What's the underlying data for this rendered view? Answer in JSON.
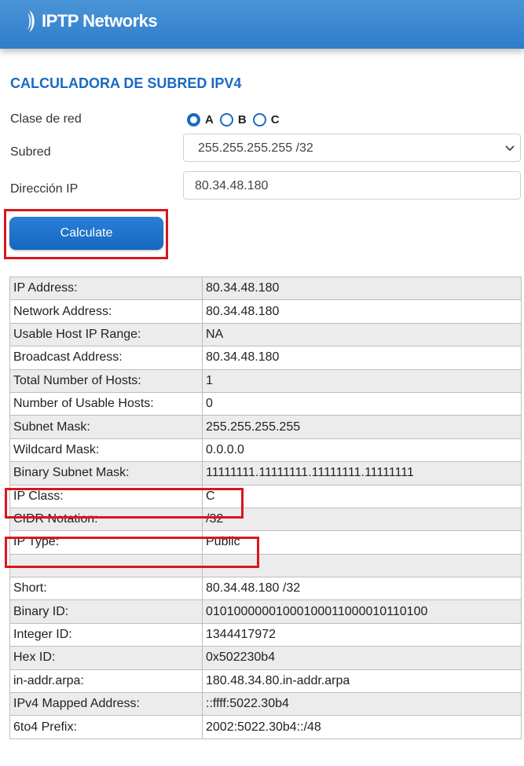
{
  "header": {
    "brand": "IPTP Networks"
  },
  "form": {
    "title": "CALCULADORA DE SUBRED IPV4",
    "class_label": "Clase de red",
    "class_options": [
      "A",
      "B",
      "C"
    ],
    "class_selected": "A",
    "subnet_label": "Subred",
    "subnet_value": "255.255.255.255 /32",
    "ip_label": "Dirección IP",
    "ip_value": "80.34.48.180",
    "calculate_label": "Calculate"
  },
  "results": [
    {
      "key": "IP Address:",
      "value": "80.34.48.180"
    },
    {
      "key": "Network Address:",
      "value": "80.34.48.180"
    },
    {
      "key": "Usable Host IP Range:",
      "value": "NA"
    },
    {
      "key": "Broadcast Address:",
      "value": "80.34.48.180"
    },
    {
      "key": "Total Number of Hosts:",
      "value": "1"
    },
    {
      "key": "Number of Usable Hosts:",
      "value": "0"
    },
    {
      "key": "Subnet Mask:",
      "value": "255.255.255.255"
    },
    {
      "key": "Wildcard Mask:",
      "value": "0.0.0.0"
    },
    {
      "key": "Binary Subnet Mask:",
      "value": "11111111.11111111.11111111.11111111"
    },
    {
      "key": "IP Class:",
      "value": "C"
    },
    {
      "key": "CIDR Notation:",
      "value": "/32"
    },
    {
      "key": "IP Type:",
      "value": "Public"
    },
    {
      "key": "",
      "value": ""
    },
    {
      "key": "Short:",
      "value": "80.34.48.180 /32"
    },
    {
      "key": "Binary ID:",
      "value": "01010000001000100011000010110100"
    },
    {
      "key": "Integer ID:",
      "value": "1344417972"
    },
    {
      "key": "Hex ID:",
      "value": "0x502230b4"
    },
    {
      "key": "in-addr.arpa:",
      "value": "180.48.34.80.in-addr.arpa"
    },
    {
      "key": "IPv4 Mapped Address:",
      "value": "::ffff:5022.30b4"
    },
    {
      "key": "6to4 Prefix:",
      "value": "2002:5022.30b4::/48"
    }
  ],
  "colors": {
    "accent": "#1a6ac1",
    "highlight": "#d9161c",
    "header": "#3a87d0"
  }
}
